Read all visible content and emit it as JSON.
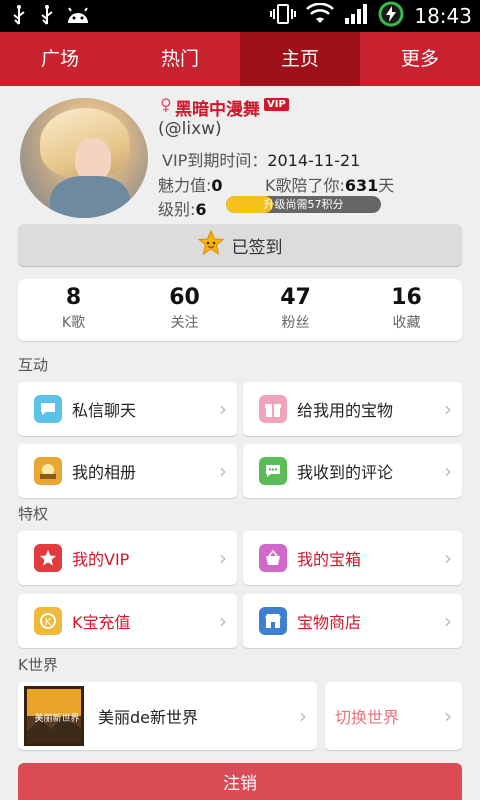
{
  "status_bar": {
    "time": "18:43"
  },
  "tabs": [
    {
      "label": "广场"
    },
    {
      "label": "热门"
    },
    {
      "label": "主页"
    },
    {
      "label": "更多"
    }
  ],
  "profile": {
    "gender_symbol": "♀",
    "nickname": "黑暗中漫舞",
    "vip_badge": "VIP",
    "uid": "(@lixw)",
    "vip_expiry_label": "VIP到期时间：",
    "vip_expiry_value": "2014-11-21",
    "charm_label": "魅力值:",
    "charm_value": "0",
    "kday_label": "K歌陪了你:",
    "kday_value": "631",
    "kday_unit": "天",
    "level_label": "级别:",
    "level_value": "6",
    "level_progress_text": "升级尚需57积分",
    "level_progress": 0.3
  },
  "signin": {
    "label": "已签到"
  },
  "stats": [
    {
      "num": "8",
      "label": "K歌"
    },
    {
      "num": "60",
      "label": "关注"
    },
    {
      "num": "47",
      "label": "粉丝"
    },
    {
      "num": "16",
      "label": "收藏"
    }
  ],
  "sections": {
    "interact": "互动",
    "privilege": "特权",
    "kworld": "K世界"
  },
  "interact": {
    "message": "私信聊天",
    "gift": "给我用的宝物",
    "album": "我的相册",
    "comments": "我收到的评论"
  },
  "privilege": {
    "vip": "我的VIP",
    "treasure": "我的宝箱",
    "recharge": "K宝充值",
    "shop": "宝物商店"
  },
  "kworld": {
    "world_thumb_text": "美丽新世界",
    "world_name": "美丽de新世界",
    "switch": "切换世界"
  },
  "logout": {
    "label": "注销"
  },
  "colors": {
    "brand_red": "#c8222e",
    "active_tab": "#9e1119",
    "accent_red": "#d1172a"
  }
}
